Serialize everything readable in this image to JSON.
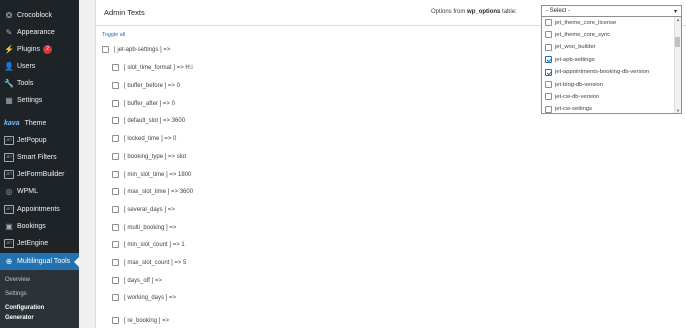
{
  "sidebar": {
    "items": [
      {
        "label": "Crocoblock",
        "icon": "crocoblock-icon",
        "glyph": "❂"
      },
      {
        "label": "Appearance",
        "icon": "paintbrush-icon",
        "glyph": "✎"
      },
      {
        "label": "Plugins",
        "icon": "plugin-icon",
        "glyph": "⚡",
        "badge": "2"
      },
      {
        "label": "Users",
        "icon": "user-icon",
        "glyph": "👤"
      },
      {
        "label": "Tools",
        "icon": "wrench-icon",
        "glyph": "🔧"
      },
      {
        "label": "Settings",
        "icon": "settings-icon",
        "glyph": "▦"
      },
      {
        "label": "Theme",
        "icon": "theme-logo-icon",
        "glyph": "kava"
      },
      {
        "label": "JetPopup",
        "icon": "jetpopup-icon",
        "glyph": "JET"
      },
      {
        "label": "Smart Filters",
        "icon": "jetsmartfilters-icon",
        "glyph": "JET"
      },
      {
        "label": "JetFormBuilder",
        "icon": "jetformbuilder-icon",
        "glyph": "JET"
      },
      {
        "label": "WPML",
        "icon": "wpml-icon",
        "glyph": "◎"
      },
      {
        "label": "Appointments",
        "icon": "appointments-icon",
        "glyph": "JET"
      },
      {
        "label": "Bookings",
        "icon": "bookings-icon",
        "glyph": "▣"
      },
      {
        "label": "JetEngine",
        "icon": "jetengine-icon",
        "glyph": "JET"
      },
      {
        "label": "Multilingual Tools",
        "icon": "multilingual-tools-icon",
        "glyph": "⊕",
        "active": true
      }
    ],
    "submenu": [
      "Overview",
      "Settings",
      "Configuration",
      "Generator"
    ]
  },
  "panel": {
    "title": "Admin Texts",
    "options_label_prefix": "Options from",
    "options_label_bold": "wp_options",
    "options_label_suffix": "table:",
    "toggle_all": "Toggle all"
  },
  "select": {
    "value": "- Select -",
    "options": [
      {
        "label": "jet_theme_core_license",
        "checked": false
      },
      {
        "label": "jet_theme_core_sync",
        "checked": false
      },
      {
        "label": "jet_woo_builder",
        "checked": false
      },
      {
        "label": "jet-apb-settings",
        "checked": true
      },
      {
        "label": "jet-appointments-booking-db-version",
        "checked": true
      },
      {
        "label": "jet-blog-db-version",
        "checked": false
      },
      {
        "label": "jet-cw-db-version",
        "checked": false
      },
      {
        "label": "jet-cw-settings",
        "checked": false
      }
    ]
  },
  "settings_rows": [
    {
      "text": "[ jet-apb-settings ] =>",
      "level": 0
    },
    {
      "text": "[ slot_time_format ] => H:i",
      "level": 1
    },
    {
      "text": "[ buffer_before ] => 0",
      "level": 1
    },
    {
      "text": "[ buffer_after ] => 0",
      "level": 1
    },
    {
      "text": "[ default_slot ] => 3600",
      "level": 1
    },
    {
      "text": "[ locked_time ] => 0",
      "level": 1
    },
    {
      "text": "[ booking_type ] => slot",
      "level": 1
    },
    {
      "text": "[ min_slot_time ] => 1800",
      "level": 1
    },
    {
      "text": "[ max_slot_time ] => 3600",
      "level": 1
    },
    {
      "text": "[ several_days ] =>",
      "level": 1
    },
    {
      "text": "[ multi_booking ] =>",
      "level": 1
    },
    {
      "text": "[ min_slot_count ] => 1",
      "level": 1
    },
    {
      "text": "[ max_slot_count ] => 5",
      "level": 1
    },
    {
      "text": "[ days_off ] =>",
      "level": 1
    },
    {
      "text": "[ working_days ] =>",
      "level": 1
    },
    {
      "text": "[ re_booking ] =>",
      "level": 1
    }
  ]
}
